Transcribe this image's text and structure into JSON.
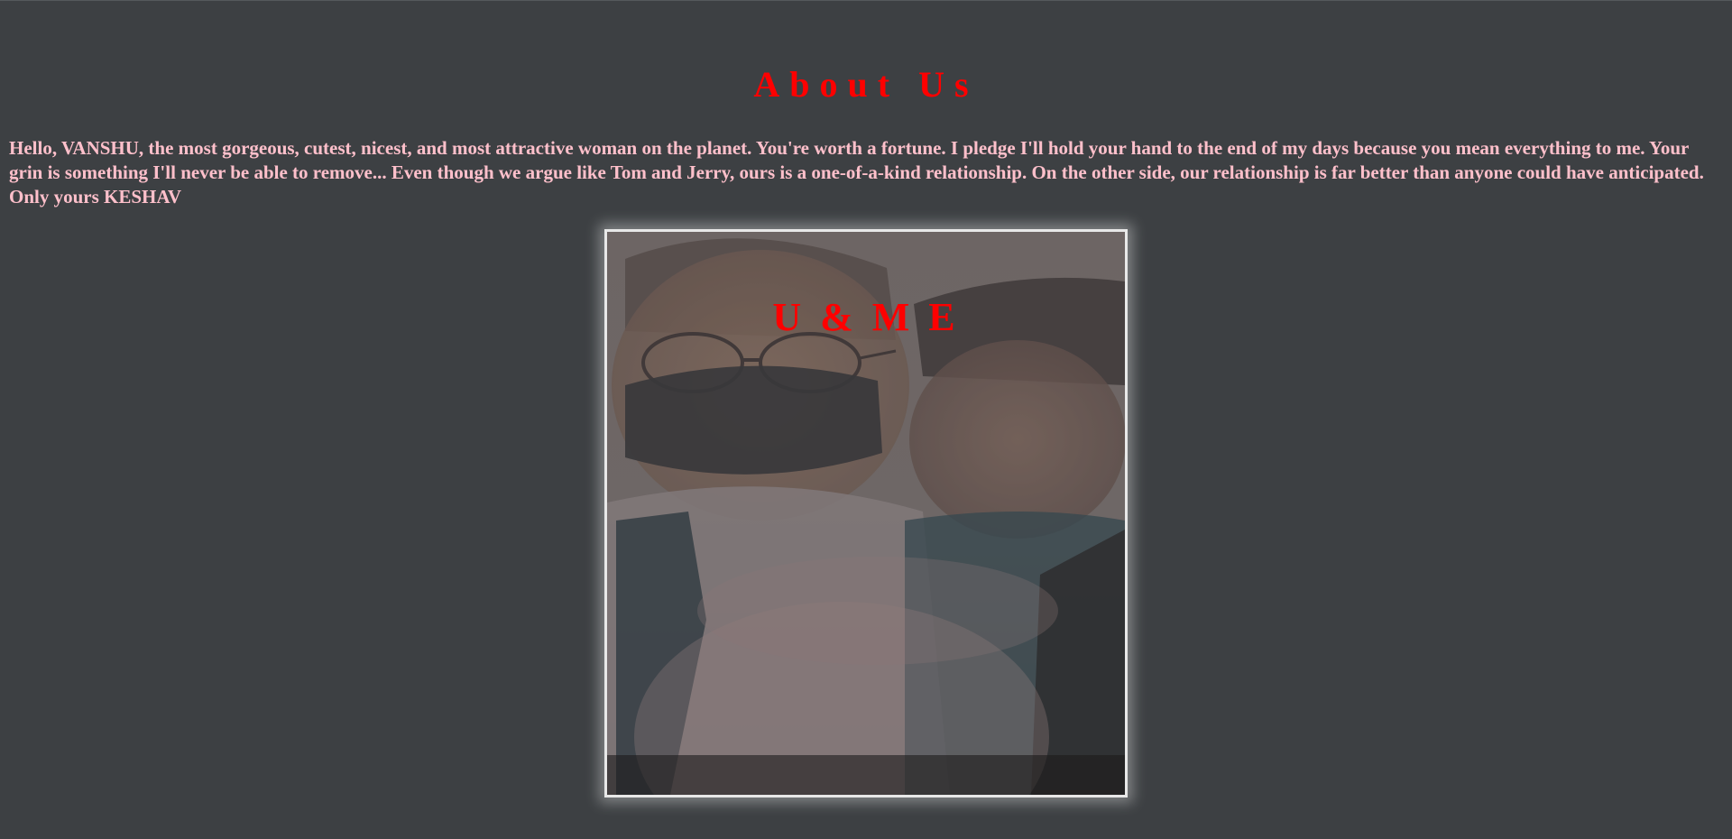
{
  "page": {
    "background_color": "#3d4043"
  },
  "about": {
    "title": "About Us",
    "title_color": "#ff0000",
    "text": "Hello, VANSHU, the most gorgeous, cutest, nicest, and most attractive woman on the planet. You're worth a fortune. I pledge I'll hold your hand to the end of my days because you mean everything to me. Your grin is something I'll never be able to remove... Even though we argue like Tom and Jerry, ours is a one-of-a-kind relationship. On the other side, our relationship is far better than anyone could have anticipated. Only yours KESHAV",
    "text_color": "#ffc0cb"
  },
  "photo": {
    "caption": "U & M E",
    "caption_color": "#ff0000",
    "content": "couple-photo"
  }
}
